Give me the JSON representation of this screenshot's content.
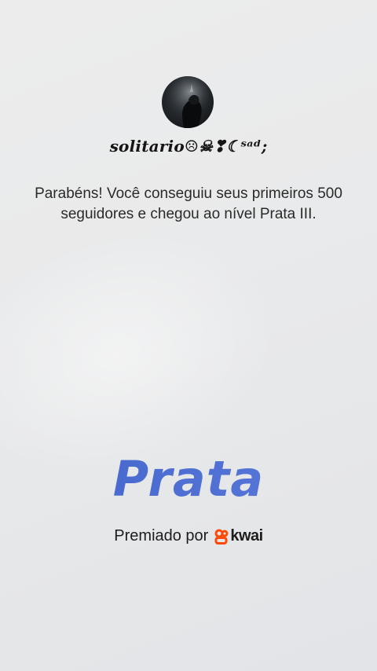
{
  "profile": {
    "username": "solitario☹☠❣☾ˢᵃᵈ;"
  },
  "message": {
    "text": "Parabéns! Você conseguiu seus primeiros 500 seguidores e chegou ao nível Prata III."
  },
  "badge": {
    "tier": "Prata"
  },
  "awarded": {
    "label": "Premiado por",
    "brand": "kwai",
    "brand_icon": "kwai-logo-icon",
    "brand_color": "#ff4906"
  },
  "colors": {
    "tier_gradient_start": "#3f62c9",
    "tier_gradient_end": "#5a7ada",
    "background": "#e9eaeb"
  },
  "icons": {
    "avatar": "profile-photo"
  }
}
